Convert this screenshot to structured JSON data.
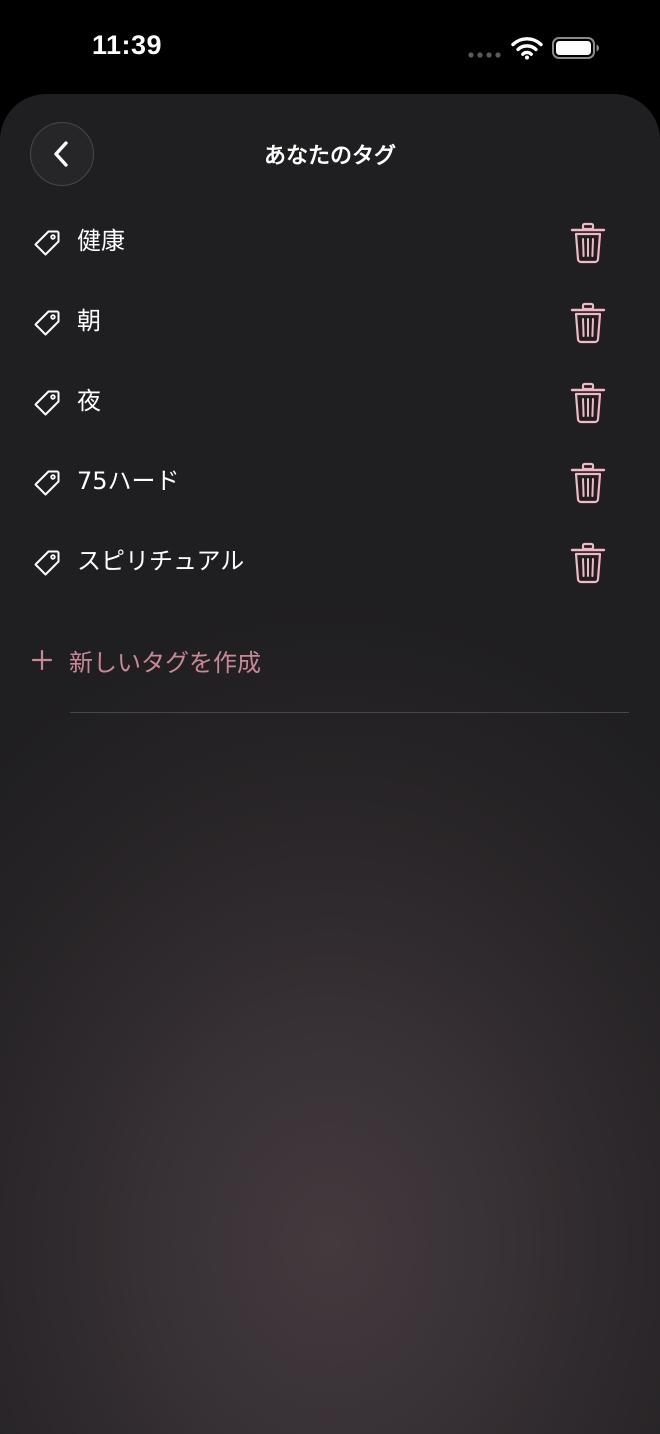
{
  "status_bar": {
    "time": "11:39"
  },
  "header": {
    "title": "あなたのタグ"
  },
  "tags": [
    {
      "label": "健康"
    },
    {
      "label": "朝"
    },
    {
      "label": "夜"
    },
    {
      "label": "75ハード"
    },
    {
      "label": "スピリチュアル"
    }
  ],
  "create_tag": {
    "label": "新しいタグを作成"
  },
  "icons": {
    "back": "chevron-left-icon",
    "tag": "tag-icon",
    "delete": "trash-icon",
    "add": "plus-icon"
  },
  "colors": {
    "accent_pink": "#f3b8c6",
    "create_text": "#c98896",
    "background": "#1f1e20"
  }
}
